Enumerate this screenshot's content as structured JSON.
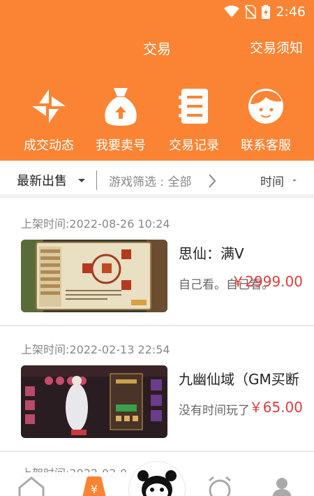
{
  "status_bar": {
    "time": "2:46"
  },
  "header": {
    "title": "交易",
    "notice_link": "交易须知"
  },
  "tiles": [
    {
      "label": "成交动态",
      "icon": "pinwheel-icon"
    },
    {
      "label": "我要卖号",
      "icon": "money-bag-icon"
    },
    {
      "label": "交易记录",
      "icon": "record-book-icon"
    },
    {
      "label": "联系客服",
      "icon": "customer-service-icon"
    }
  ],
  "filter": {
    "latest": "最新出售",
    "game_filter": "游戏筛选 : 全部",
    "sort": "时间"
  },
  "listings": [
    {
      "time": "上架时间:2022-08-26 10:24",
      "name": "思仙：满V",
      "desc": "自己看。自己看。",
      "price": "￥2999.00"
    },
    {
      "time": "上架时间:2022-02-13 22:54",
      "name": "九幽仙域（GM买断",
      "desc": "没有时间玩了",
      "price": "￥65.00"
    }
  ],
  "partial_listing": {
    "time": "上架时间:2022-02-0"
  },
  "colors": {
    "brand": "#fb8434",
    "price": "#e03c3c"
  }
}
